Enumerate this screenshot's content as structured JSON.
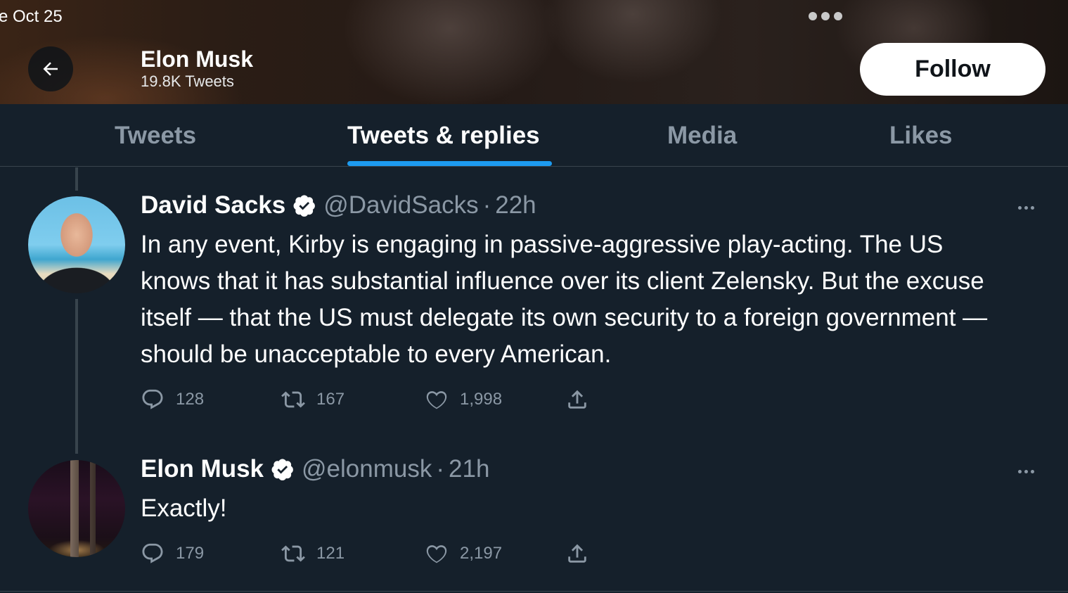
{
  "status_bar": {
    "date": "e Oct 25"
  },
  "header": {
    "name": "Elon Musk",
    "tweet_count": "19.8K Tweets",
    "follow_label": "Follow"
  },
  "tabs": [
    {
      "label": "Tweets",
      "active": false
    },
    {
      "label": "Tweets & replies",
      "active": true
    },
    {
      "label": "Media",
      "active": false
    },
    {
      "label": "Likes",
      "active": false
    }
  ],
  "tweets": [
    {
      "name": "David Sacks",
      "verified": true,
      "handle": "@DavidSacks",
      "separator": "·",
      "time": "22h",
      "text": "In any event, Kirby is engaging in passive-aggressive play-acting. The US knows that it has substantial influence over its client Zelensky. But the excuse itself — that the US must delegate its own security to a foreign government — should be unacceptable to every American.",
      "replies": "128",
      "retweets": "167",
      "likes": "1,998"
    },
    {
      "name": "Elon Musk",
      "verified": true,
      "handle": "@elonmusk",
      "separator": "·",
      "time": "21h",
      "text": "Exactly!",
      "replies": "179",
      "retweets": "121",
      "likes": "2,197"
    }
  ],
  "icons": {
    "back": "arrow-left-icon",
    "more": "more-horizontal-icon",
    "verified": "verified-badge-icon",
    "reply": "reply-icon",
    "retweet": "retweet-icon",
    "like": "heart-icon",
    "share": "share-icon"
  },
  "colors": {
    "background": "#15202b",
    "accent": "#1d9bf0",
    "muted_text": "#8b98a5",
    "border": "#38444d"
  }
}
